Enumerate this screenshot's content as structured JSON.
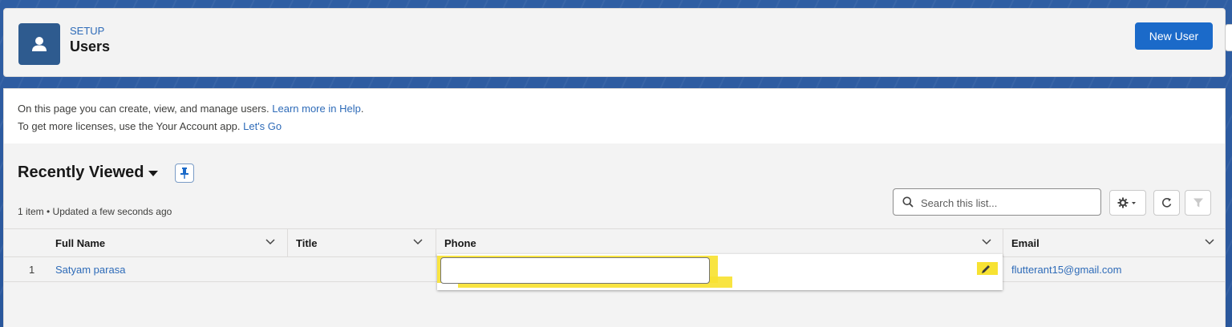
{
  "header": {
    "section": "SETUP",
    "title": "Users",
    "new_user_label": "New User",
    "icon": "user-icon"
  },
  "info": {
    "line1_text": "On this page you can create, view, and manage users. ",
    "line1_link": "Learn more in Help",
    "line1_end": ".",
    "line2_text": "To get more licenses, use the Your Account app. ",
    "line2_link": "Let's Go"
  },
  "list": {
    "title": "Recently Viewed",
    "meta": "1 item • Updated a few seconds ago",
    "search_placeholder": "Search this list...",
    "columns": [
      {
        "label": "Full Name"
      },
      {
        "label": "Title"
      },
      {
        "label": "Phone"
      },
      {
        "label": "Email"
      }
    ],
    "rows": [
      {
        "num": "1",
        "full_name": "Satyam parasa",
        "title": "",
        "phone": "",
        "email": "flutterant15@gmail.com"
      }
    ]
  },
  "colors": {
    "brand_blue": "#1b6ac9",
    "link_blue": "#2e6bb8",
    "highlight_yellow": "#f7e232"
  }
}
